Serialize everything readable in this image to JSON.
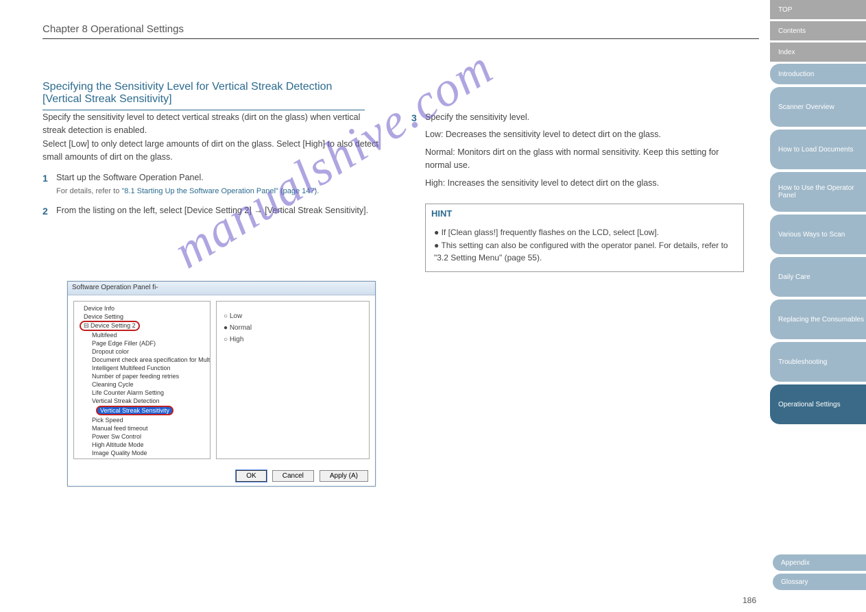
{
  "chapter": "Chapter 8 Operational Settings",
  "section_title": "Specifying the Sensitivity Level for Vertical Streak Detection [Vertical Streak Sensitivity]",
  "intro": "Specify the sensitivity level to detect vertical streaks (dirt on the glass) when vertical streak detection is enabled.\nSelect [Low] to only detect large amounts of dirt on the glass. Select [High] to also detect small amounts of dirt on the glass.",
  "step1_num": "1",
  "step1_text": "Start up the Software Operation Panel.",
  "step1_hint_prefix": "For details, refer to ",
  "step1_ref": "\"8.1 Starting Up the Software Operation Panel\" (page 147)",
  "step1_hint_suffix": ".",
  "step2_num": "2",
  "step2_text": "From the listing on the left, select [Device Setting 2] → [Vertical Streak Sensitivity].",
  "step3_num": "3",
  "step3_text": "Specify the sensitivity level.",
  "opt_low_label": "Low",
  "opt_low_desc": ": Decreases the sensitivity level to detect dirt on the glass.",
  "opt_normal_label": "Normal",
  "opt_normal_desc": ": Monitors dirt on the glass with normal sensitivity. Keep this setting for normal use.",
  "opt_high_label": "High",
  "opt_high_desc": ": Increases the sensitivity level to detect dirt on the glass.",
  "hint_head": "HINT",
  "hint_b1": "If [Clean glass!] frequently flashes on the LCD, select [Low].",
  "hint_b2_pre": "This setting can also be configured with the operator panel. For details, refer to ",
  "hint_b2_ref": "\"3.2 Setting Menu\" (page 55)",
  "hint_b2_post": ".",
  "dialog": {
    "title": "Software Operation Panel fi-",
    "tree": {
      "i1": "Device Info",
      "i2": "Device Setting",
      "i3": "Device Setting 2",
      "s1": "Multifeed",
      "s2": "Page Edge Filler (ADF)",
      "s3": "Dropout color",
      "s4": "Document check area specification for Multifeed Detection",
      "s5": "Intelligent Multifeed Function",
      "s6": "Number of paper feeding retries",
      "s7": "Cleaning Cycle",
      "s8": "Life Counter Alarm Setting",
      "s9": "Vertical Streak Detection",
      "s10": "Vertical Streak Sensitivity",
      "s11": "Pick Speed",
      "s12": "Manual feed timeout",
      "s13": "Power Sw Control",
      "s14": "High Altitude Mode",
      "s15": "Image Quality Mode"
    },
    "r_low": "Low",
    "r_normal": "Normal",
    "r_high": "High",
    "btn_ok": "OK",
    "btn_cancel": "Cancel",
    "btn_apply": "Apply (A)"
  },
  "sidebar": {
    "g1": "TOP",
    "g2": "Contents",
    "g3": "Index",
    "b0": "Introduction",
    "b1": "Scanner Overview",
    "b2": "How to Load Documents",
    "b3": "How to Use the Operator Panel",
    "b4": "Various Ways to Scan",
    "b5": "Daily Care",
    "b6": "Replacing the Consumables",
    "b7": "Troubleshooting",
    "b8": "Operational Settings",
    "bot1": "Appendix",
    "bot2": "Glossary"
  },
  "watermark": "manualshive.com",
  "page_num": "186"
}
